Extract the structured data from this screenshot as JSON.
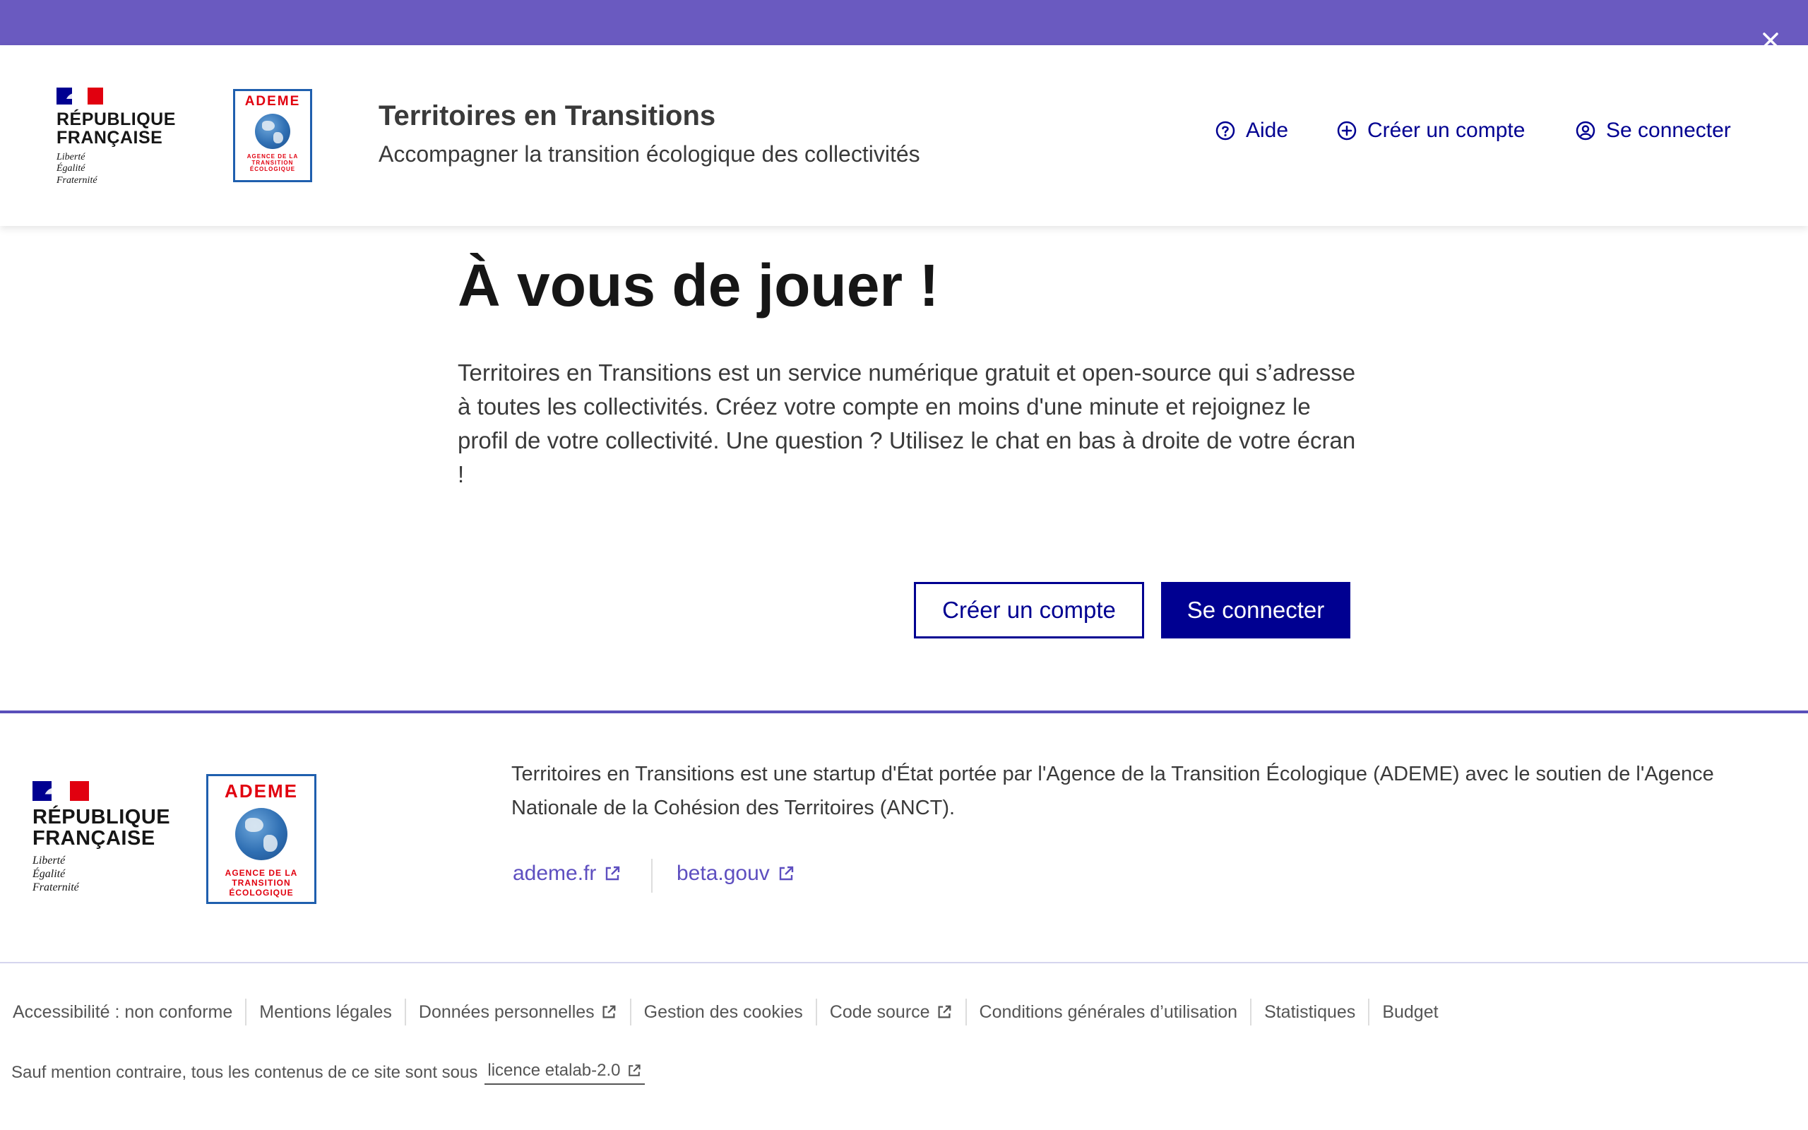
{
  "header": {
    "republique_line1": "RÉPUBLIQUE",
    "republique_line2": "FRANÇAISE",
    "motto": [
      "Liberté",
      "Égalité",
      "Fraternité"
    ],
    "ademe_name": "ADEME",
    "ademe_sub": [
      "AGENCE DE LA",
      "TRANSITION",
      "ÉCOLOGIQUE"
    ],
    "service_title": "Territoires en Transitions",
    "service_tagline": "Accompagner la transition écologique des collectivités",
    "nav": {
      "aide": "Aide",
      "creer_compte": "Créer un compte",
      "se_connecter": "Se connecter"
    }
  },
  "main": {
    "title": "À vous de jouer !",
    "intro": "Territoires en Transitions est un service numérique gratuit et open-source qui s’adresse à toutes les collectivités. Créez votre compte en moins d'une minute et rejoignez le profil de votre collectivité. Une question ? Utilisez le chat en bas à droite de votre écran !",
    "btn_creer": "Créer un compte",
    "btn_connecter": "Se connecter"
  },
  "footer": {
    "description": "Territoires en Transitions est une startup d'État portée par l'Agence de la Transition Écologique (ADEME) avec le soutien de l'Agence Nationale de la Cohésion des Territoires (ANCT).",
    "links": {
      "ademe": "ademe.fr",
      "beta": "beta.gouv"
    },
    "bottom_links": {
      "accessibilite": "Accessibilité : non conforme",
      "mentions": "Mentions légales",
      "donnees": "Données personnelles",
      "cookies": "Gestion des cookies",
      "code_source": "Code source",
      "cgu": "Conditions générales d’utilisation",
      "stats": "Statistiques",
      "budget": "Budget"
    },
    "licence_text": "Sauf mention contraire, tous les contenus de ce site sont sous",
    "licence_link": "licence etalab-2.0"
  },
  "colors": {
    "topbar": "#6a5ac0",
    "primary": "#000091",
    "link": "#5e4fc0",
    "marianne_red": "#e1000f"
  }
}
